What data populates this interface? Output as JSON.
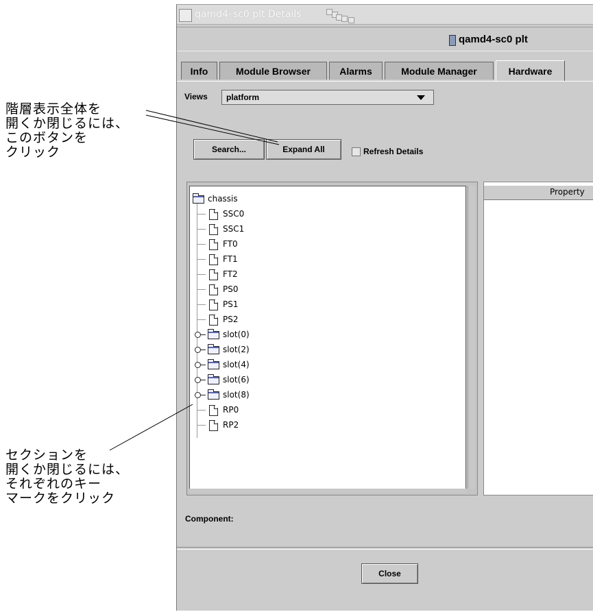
{
  "callouts": {
    "expand_all": "階層表示全体を\n開くか閉じるには、\nこのボタンを\nクリック",
    "expand_node": "セクションを\n開くか閉じるには、\nそれぞれのキー\nマークをクリック"
  },
  "window": {
    "title": "qamd4–sc0 plt Details",
    "header_title": "qamd4-sc0 plt"
  },
  "tabs": [
    {
      "label": "Info",
      "active": false
    },
    {
      "label": "Module Browser",
      "active": false
    },
    {
      "label": "Alarms",
      "active": false
    },
    {
      "label": "Module Manager",
      "active": false
    },
    {
      "label": "Hardware",
      "active": true
    }
  ],
  "views": {
    "label": "Views",
    "selected": "platform"
  },
  "toolbar": {
    "search_label": "Search...",
    "expand_all_label": "Expand All",
    "refresh_label": "Refresh Details",
    "refresh_checked": false
  },
  "tree": {
    "root": "chassis",
    "children": [
      {
        "label": "SSC0",
        "type": "leaf"
      },
      {
        "label": "SSC1",
        "type": "leaf"
      },
      {
        "label": "FT0",
        "type": "leaf"
      },
      {
        "label": "FT1",
        "type": "leaf"
      },
      {
        "label": "FT2",
        "type": "leaf"
      },
      {
        "label": "PS0",
        "type": "leaf"
      },
      {
        "label": "PS1",
        "type": "leaf"
      },
      {
        "label": "PS2",
        "type": "leaf"
      },
      {
        "label": "slot(0)",
        "type": "folder"
      },
      {
        "label": "slot(2)",
        "type": "folder"
      },
      {
        "label": "slot(4)",
        "type": "folder"
      },
      {
        "label": "slot(6)",
        "type": "folder"
      },
      {
        "label": "slot(8)",
        "type": "folder"
      },
      {
        "label": "RP0",
        "type": "leaf"
      },
      {
        "label": "RP2",
        "type": "leaf"
      }
    ]
  },
  "properties": {
    "column_header": "Property"
  },
  "details": {
    "component_label": "Component:"
  },
  "footer": {
    "close_label": "Close"
  }
}
